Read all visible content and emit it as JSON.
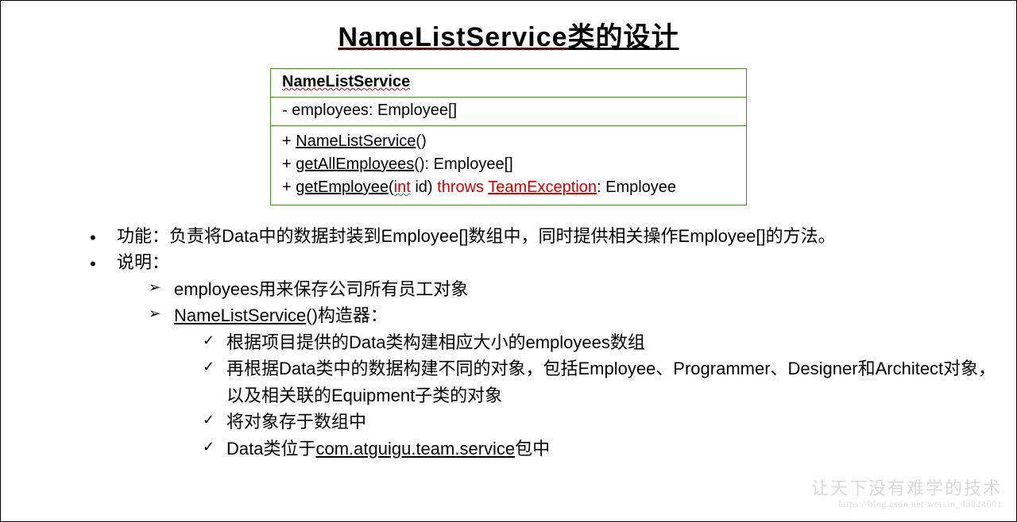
{
  "title_pre": "NameListService",
  "title_post": "类的设计",
  "uml": {
    "class_name": "NameListService",
    "field_line": "- employees: Employee[]",
    "method1_pre": "+ ",
    "method1_name": "NameListService",
    "method1_post": "()",
    "method2_pre": "+ ",
    "method2_name": "getAllEmployees",
    "method2_post": "(): Employee[]",
    "method3_pre": "+ ",
    "method3_name": "getEmployee",
    "method3_mid1": "(",
    "method3_int": "int",
    "method3_mid2": " id) ",
    "method3_throws": "throws ",
    "method3_exc": "TeamException",
    "method3_post": ": Employee"
  },
  "bullets": {
    "b1_label": "功能：",
    "b1_text": "负责将Data中的数据封装到Employee[]数组中，同时提供相关操作Employee[]的方法。",
    "b2_label": "说明：",
    "s1": "employees用来保存公司所有员工对象",
    "s2_name": "NameListService",
    "s2_post": "()构造器：",
    "c1": "根据项目提供的Data类构建相应大小的employees数组",
    "c2": "再根据Data类中的数据构建不同的对象，包括Employee、Programmer、Designer和Architect对象，以及相关联的Equipment子类的对象",
    "c3": "将对象存于数组中",
    "c4_pre": "Data类位于",
    "c4_pkg": "com.atguigu.team.service",
    "c4_post": "包中"
  },
  "watermark": {
    "main": "让天下没有难学的技术",
    "sub": "https://blog.csdn.net/weixin_43824601"
  }
}
